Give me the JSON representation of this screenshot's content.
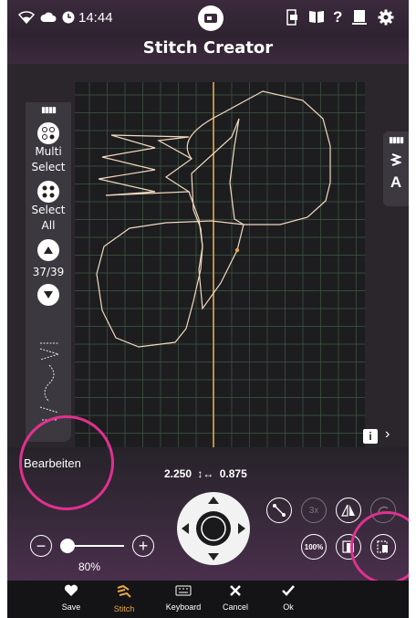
{
  "status_bar": {
    "time": "14:44"
  },
  "title": "Stitch Creator",
  "left_panel": {
    "multi_select_label": "Multi\nSelect",
    "select_all_label": "Select\nAll",
    "page_counter": "37/39"
  },
  "right_panel": {
    "text_tool_label": "A"
  },
  "edit_label": "Bearbeiten",
  "coordinates": {
    "x": "2.250",
    "y": "0.875"
  },
  "zoom": {
    "value": "80%",
    "level": 0.0
  },
  "nav": [
    {
      "label": "Save",
      "icon": "heart-icon",
      "active": false
    },
    {
      "label": "Stitch",
      "icon": "stitch-icon",
      "active": true
    },
    {
      "label": "Keyboard",
      "icon": "keyboard-icon",
      "active": false
    },
    {
      "label": "Cancel",
      "icon": "close-icon",
      "active": false
    },
    {
      "label": "Ok",
      "icon": "check-icon",
      "active": false
    }
  ],
  "colors": {
    "accent": "#e6a64a",
    "stitch": "#f2d9c0",
    "annotation": "#e0318f",
    "nav_active": "#e6a64a"
  }
}
